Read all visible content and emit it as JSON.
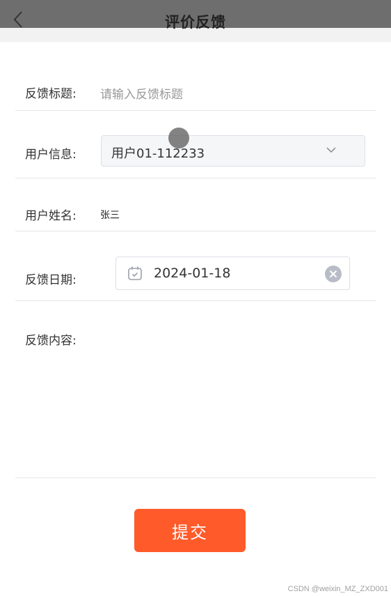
{
  "nav": {
    "title": "评价反馈",
    "back_icon": "chevron-left-icon"
  },
  "form": {
    "title_field": {
      "label": "反馈标题:",
      "placeholder": "请输入反馈标题",
      "value": ""
    },
    "user_info": {
      "label": "用户信息:",
      "selected": "用户01-112233",
      "icon": "chevron-down-icon"
    },
    "user_name": {
      "label": "用户姓名:",
      "value": "张三"
    },
    "feedback_date": {
      "label": "反馈日期:",
      "value": "2024-01-18",
      "icons": [
        "calendar-icon",
        "clear-icon"
      ]
    },
    "content": {
      "label": "反馈内容:",
      "value": ""
    }
  },
  "submit": {
    "label": "提交",
    "color": "#ff5a2a"
  },
  "watermark": "CSDN @weixin_MZ_ZXD001"
}
